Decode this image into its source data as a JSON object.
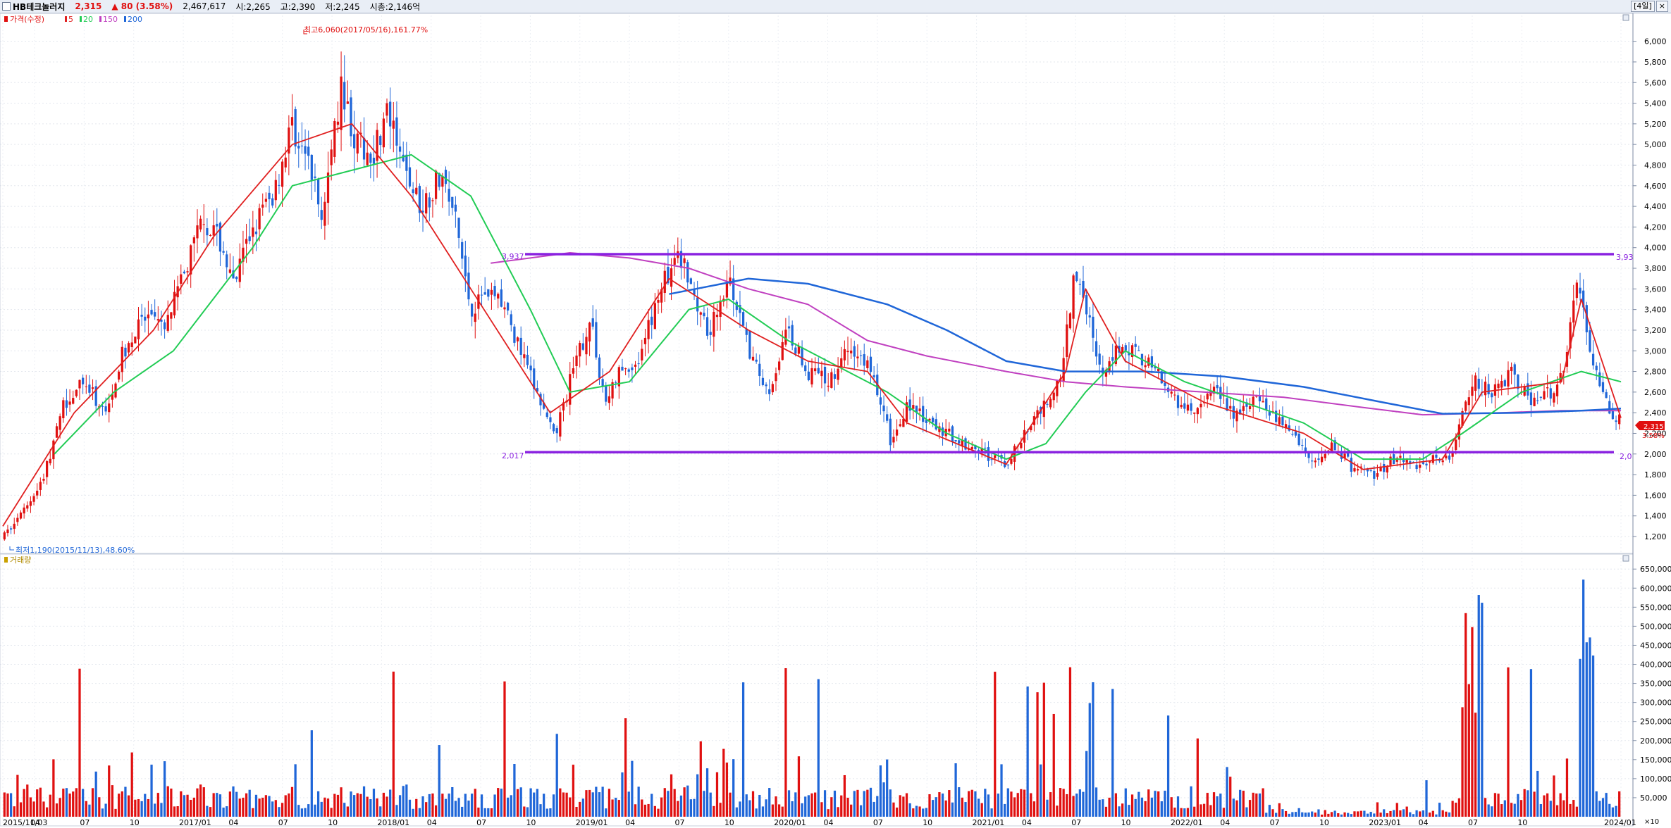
{
  "header": {
    "name": "HB테크놀러지",
    "price": "2,315",
    "change": "▲ 80 (3.58%)",
    "volume": "2,467,617",
    "open": "시:2,265",
    "high": "고:2,390",
    "low": "저:2,245",
    "mktcap": "시총:2,146억",
    "interval_button": "[4일]",
    "close_button": "×"
  },
  "legend": {
    "price_label": "가격(수정)",
    "ma": [
      {
        "label": "5",
        "color": "#e02020"
      },
      {
        "label": "20",
        "color": "#22cc55"
      },
      {
        "label": "150",
        "color": "#c040c0"
      },
      {
        "label": "200",
        "color": "#1f66d8"
      }
    ],
    "volume_label": "거래량"
  },
  "annotations": {
    "high": "최고6,060(2017/05/16),161.77%",
    "low": "최저1,190(2015/11/13),48.60%",
    "resistance_label": "3,937",
    "support_label": "2,017",
    "resistance_right": "3,93",
    "support_right": "2,0",
    "last_price_tag": "2,315",
    "last_pct_tag": "3.58%",
    "volume_unit": "×10"
  },
  "colors": {
    "up": "#e01010",
    "down": "#1f66d8",
    "ma5": "#e02020",
    "ma20": "#22cc55",
    "ma150": "#c040c0",
    "ma200": "#1f66d8",
    "hline": "#8a22e0"
  },
  "chart_data": {
    "type": "candlestick",
    "x_ticks": [
      "2015/11/03",
      "04",
      "07",
      "10",
      "2017/01",
      "04",
      "07",
      "10",
      "2018/01",
      "04",
      "07",
      "10",
      "2019/01",
      "04",
      "07",
      "10",
      "2020/01",
      "04",
      "07",
      "10",
      "2021/01",
      "04",
      "07",
      "10",
      "2022/01",
      "04",
      "07",
      "10",
      "2023/01",
      "04",
      "07",
      "10",
      "2024/01"
    ],
    "y_ticks": [
      "1,200",
      "1,400",
      "1,600",
      "1,800",
      "2,000",
      "2,200",
      "2,400",
      "2,600",
      "2,800",
      "3,000",
      "3,200",
      "3,400",
      "3,600",
      "3,800",
      "4,000",
      "4,200",
      "4,400",
      "4,600",
      "4,800",
      "5,000",
      "5,200",
      "5,400",
      "5,600",
      "5,800",
      "6,000"
    ],
    "ylim": [
      1050,
      6250
    ],
    "volume_ticks": [
      "50,000",
      "100,000",
      "150,000",
      "200,000",
      "250,000",
      "300,000",
      "350,000",
      "400,000",
      "450,000",
      "500,000",
      "550,000",
      "600,000",
      "650,000"
    ],
    "volume_ylim": [
      0,
      680000
    ],
    "hlines": [
      3937,
      2017
    ],
    "period_years": [
      2015.84,
      2024.0
    ],
    "price_path": [
      [
        2015.84,
        1190
      ],
      [
        2015.95,
        1450
      ],
      [
        2016.05,
        1800
      ],
      [
        2016.15,
        2500
      ],
      [
        2016.25,
        2700
      ],
      [
        2016.35,
        2400
      ],
      [
        2016.45,
        3000
      ],
      [
        2016.55,
        3300
      ],
      [
        2016.65,
        3200
      ],
      [
        2016.75,
        3700
      ],
      [
        2016.85,
        4300
      ],
      [
        2016.95,
        4000
      ],
      [
        2017.0,
        3600
      ],
      [
        2017.1,
        4200
      ],
      [
        2017.2,
        4500
      ],
      [
        2017.3,
        5200
      ],
      [
        2017.38,
        4800
      ],
      [
        2017.45,
        4300
      ],
      [
        2017.55,
        5600
      ],
      [
        2017.62,
        5000
      ],
      [
        2017.7,
        4900
      ],
      [
        2017.78,
        5300
      ],
      [
        2017.85,
        4800
      ],
      [
        2017.95,
        4400
      ],
      [
        2018.05,
        4700
      ],
      [
        2018.12,
        4300
      ],
      [
        2018.2,
        3400
      ],
      [
        2018.28,
        3600
      ],
      [
        2018.35,
        3500
      ],
      [
        2018.45,
        3000
      ],
      [
        2018.55,
        2500
      ],
      [
        2018.62,
        2150
      ],
      [
        2018.7,
        2700
      ],
      [
        2018.8,
        3300
      ],
      [
        2018.88,
        2500
      ],
      [
        2018.95,
        2800
      ],
      [
        2019.05,
        2900
      ],
      [
        2019.15,
        3600
      ],
      [
        2019.25,
        3900
      ],
      [
        2019.3,
        3700
      ],
      [
        2019.4,
        3200
      ],
      [
        2019.5,
        3700
      ],
      [
        2019.6,
        3000
      ],
      [
        2019.7,
        2600
      ],
      [
        2019.8,
        3200
      ],
      [
        2019.9,
        2800
      ],
      [
        2020.0,
        2700
      ],
      [
        2020.1,
        3000
      ],
      [
        2020.2,
        2900
      ],
      [
        2020.28,
        2400
      ],
      [
        2020.32,
        2100
      ],
      [
        2020.4,
        2500
      ],
      [
        2020.5,
        2300
      ],
      [
        2020.6,
        2200
      ],
      [
        2020.7,
        2100
      ],
      [
        2020.8,
        2000
      ],
      [
        2020.9,
        1900
      ],
      [
        2021.0,
        2200
      ],
      [
        2021.1,
        2500
      ],
      [
        2021.18,
        2800
      ],
      [
        2021.25,
        3800
      ],
      [
        2021.3,
        3500
      ],
      [
        2021.38,
        2700
      ],
      [
        2021.48,
        3100
      ],
      [
        2021.55,
        3000
      ],
      [
        2021.65,
        2800
      ],
      [
        2021.75,
        2500
      ],
      [
        2021.85,
        2400
      ],
      [
        2021.95,
        2600
      ],
      [
        2022.05,
        2400
      ],
      [
        2022.15,
        2500
      ],
      [
        2022.25,
        2400
      ],
      [
        2022.35,
        2200
      ],
      [
        2022.45,
        1900
      ],
      [
        2022.55,
        2100
      ],
      [
        2022.65,
        1850
      ],
      [
        2022.75,
        1800
      ],
      [
        2022.85,
        1950
      ],
      [
        2022.95,
        1900
      ],
      [
        2023.05,
        1950
      ],
      [
        2023.15,
        2000
      ],
      [
        2023.25,
        2700
      ],
      [
        2023.35,
        2600
      ],
      [
        2023.45,
        2800
      ],
      [
        2023.55,
        2500
      ],
      [
        2023.65,
        2600
      ],
      [
        2023.72,
        2900
      ],
      [
        2023.78,
        3700
      ],
      [
        2023.85,
        2900
      ],
      [
        2023.92,
        2500
      ],
      [
        2024.0,
        2315
      ]
    ],
    "ma5_path": [
      [
        2015.84,
        1300
      ],
      [
        2016.2,
        2400
      ],
      [
        2016.6,
        3200
      ],
      [
        2016.9,
        4100
      ],
      [
        2017.3,
        5000
      ],
      [
        2017.6,
        5200
      ],
      [
        2017.9,
        4500
      ],
      [
        2018.2,
        3600
      ],
      [
        2018.6,
        2400
      ],
      [
        2018.9,
        2800
      ],
      [
        2019.2,
        3700
      ],
      [
        2019.6,
        3200
      ],
      [
        2019.9,
        2900
      ],
      [
        2020.2,
        2800
      ],
      [
        2020.4,
        2300
      ],
      [
        2020.9,
        1900
      ],
      [
        2021.2,
        2800
      ],
      [
        2021.3,
        3600
      ],
      [
        2021.5,
        2900
      ],
      [
        2021.9,
        2500
      ],
      [
        2022.4,
        2200
      ],
      [
        2022.7,
        1850
      ],
      [
        2023.1,
        1950
      ],
      [
        2023.3,
        2600
      ],
      [
        2023.7,
        2700
      ],
      [
        2023.8,
        3500
      ],
      [
        2024.0,
        2350
      ]
    ],
    "ma20_path": [
      [
        2016.1,
        2000
      ],
      [
        2016.4,
        2600
      ],
      [
        2016.7,
        3000
      ],
      [
        2016.9,
        3500
      ],
      [
        2017.1,
        4000
      ],
      [
        2017.3,
        4600
      ],
      [
        2017.7,
        4800
      ],
      [
        2017.9,
        4900
      ],
      [
        2018.2,
        4500
      ],
      [
        2018.5,
        3400
      ],
      [
        2018.7,
        2600
      ],
      [
        2019.0,
        2700
      ],
      [
        2019.3,
        3400
      ],
      [
        2019.5,
        3500
      ],
      [
        2019.8,
        3100
      ],
      [
        2020.1,
        2800
      ],
      [
        2020.3,
        2600
      ],
      [
        2020.6,
        2200
      ],
      [
        2020.9,
        1950
      ],
      [
        2021.1,
        2100
      ],
      [
        2021.3,
        2600
      ],
      [
        2021.5,
        3000
      ],
      [
        2021.8,
        2700
      ],
      [
        2022.1,
        2500
      ],
      [
        2022.4,
        2300
      ],
      [
        2022.7,
        1950
      ],
      [
        2023.0,
        1950
      ],
      [
        2023.2,
        2200
      ],
      [
        2023.5,
        2600
      ],
      [
        2023.8,
        2800
      ],
      [
        2024.0,
        2700
      ]
    ],
    "ma150_path": [
      [
        2018.3,
        3850
      ],
      [
        2018.7,
        3950
      ],
      [
        2019.0,
        3900
      ],
      [
        2019.3,
        3800
      ],
      [
        2019.6,
        3600
      ],
      [
        2019.9,
        3450
      ],
      [
        2020.2,
        3100
      ],
      [
        2020.5,
        2950
      ],
      [
        2020.9,
        2800
      ],
      [
        2021.2,
        2700
      ],
      [
        2021.5,
        2650
      ],
      [
        2021.9,
        2600
      ],
      [
        2022.3,
        2550
      ],
      [
        2022.7,
        2450
      ],
      [
        2023.0,
        2380
      ],
      [
        2023.4,
        2400
      ],
      [
        2023.7,
        2420
      ],
      [
        2024.0,
        2420
      ]
    ],
    "ma200_path": [
      [
        2019.2,
        3550
      ],
      [
        2019.6,
        3700
      ],
      [
        2019.9,
        3650
      ],
      [
        2020.3,
        3450
      ],
      [
        2020.6,
        3200
      ],
      [
        2020.9,
        2900
      ],
      [
        2021.2,
        2800
      ],
      [
        2021.6,
        2800
      ],
      [
        2022.0,
        2750
      ],
      [
        2022.4,
        2650
      ],
      [
        2022.8,
        2500
      ],
      [
        2023.1,
        2390
      ],
      [
        2023.5,
        2400
      ],
      [
        2023.8,
        2420
      ],
      [
        2024.0,
        2440
      ]
    ]
  }
}
